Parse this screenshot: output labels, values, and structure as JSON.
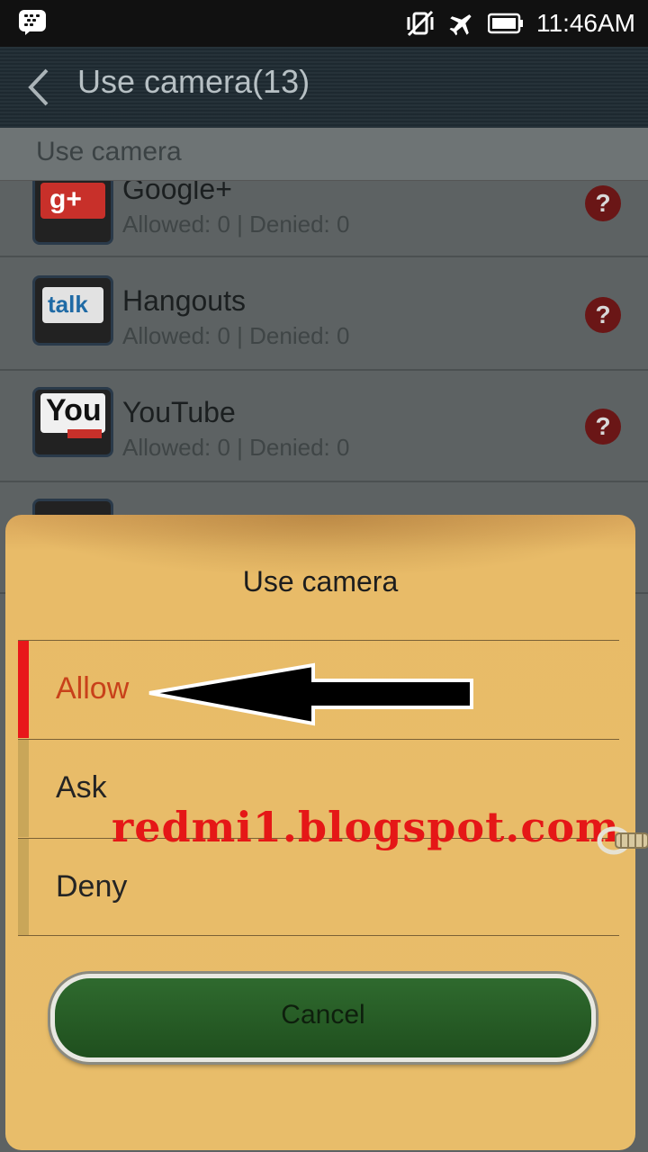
{
  "status_bar": {
    "time": "11:46AM"
  },
  "header": {
    "title": "Use camera(13)"
  },
  "section": {
    "label": "Use camera"
  },
  "apps": [
    {
      "name": "Google+",
      "stats": "Allowed: 0 | Denied: 0",
      "icon": "google-plus-icon"
    },
    {
      "name": "Hangouts",
      "stats": "Allowed: 0 | Denied: 0",
      "icon": "hangouts-talk-icon",
      "icon_text": "talk"
    },
    {
      "name": "YouTube",
      "stats": "Allowed: 0 | Denied: 0",
      "icon": "youtube-icon",
      "icon_text": "You"
    }
  ],
  "dialog": {
    "title": "Use camera",
    "options": [
      {
        "label": "Allow",
        "selected": true
      },
      {
        "label": "Ask",
        "selected": false
      },
      {
        "label": "Deny",
        "selected": false
      }
    ],
    "cancel_label": "Cancel"
  },
  "watermark": "redmi1.blogspot.com",
  "colors": {
    "selected": "#c8411a",
    "accent_bar": "#e8171a",
    "button": "#2f6a2e",
    "dialog_bg": "#e8bd6a"
  }
}
